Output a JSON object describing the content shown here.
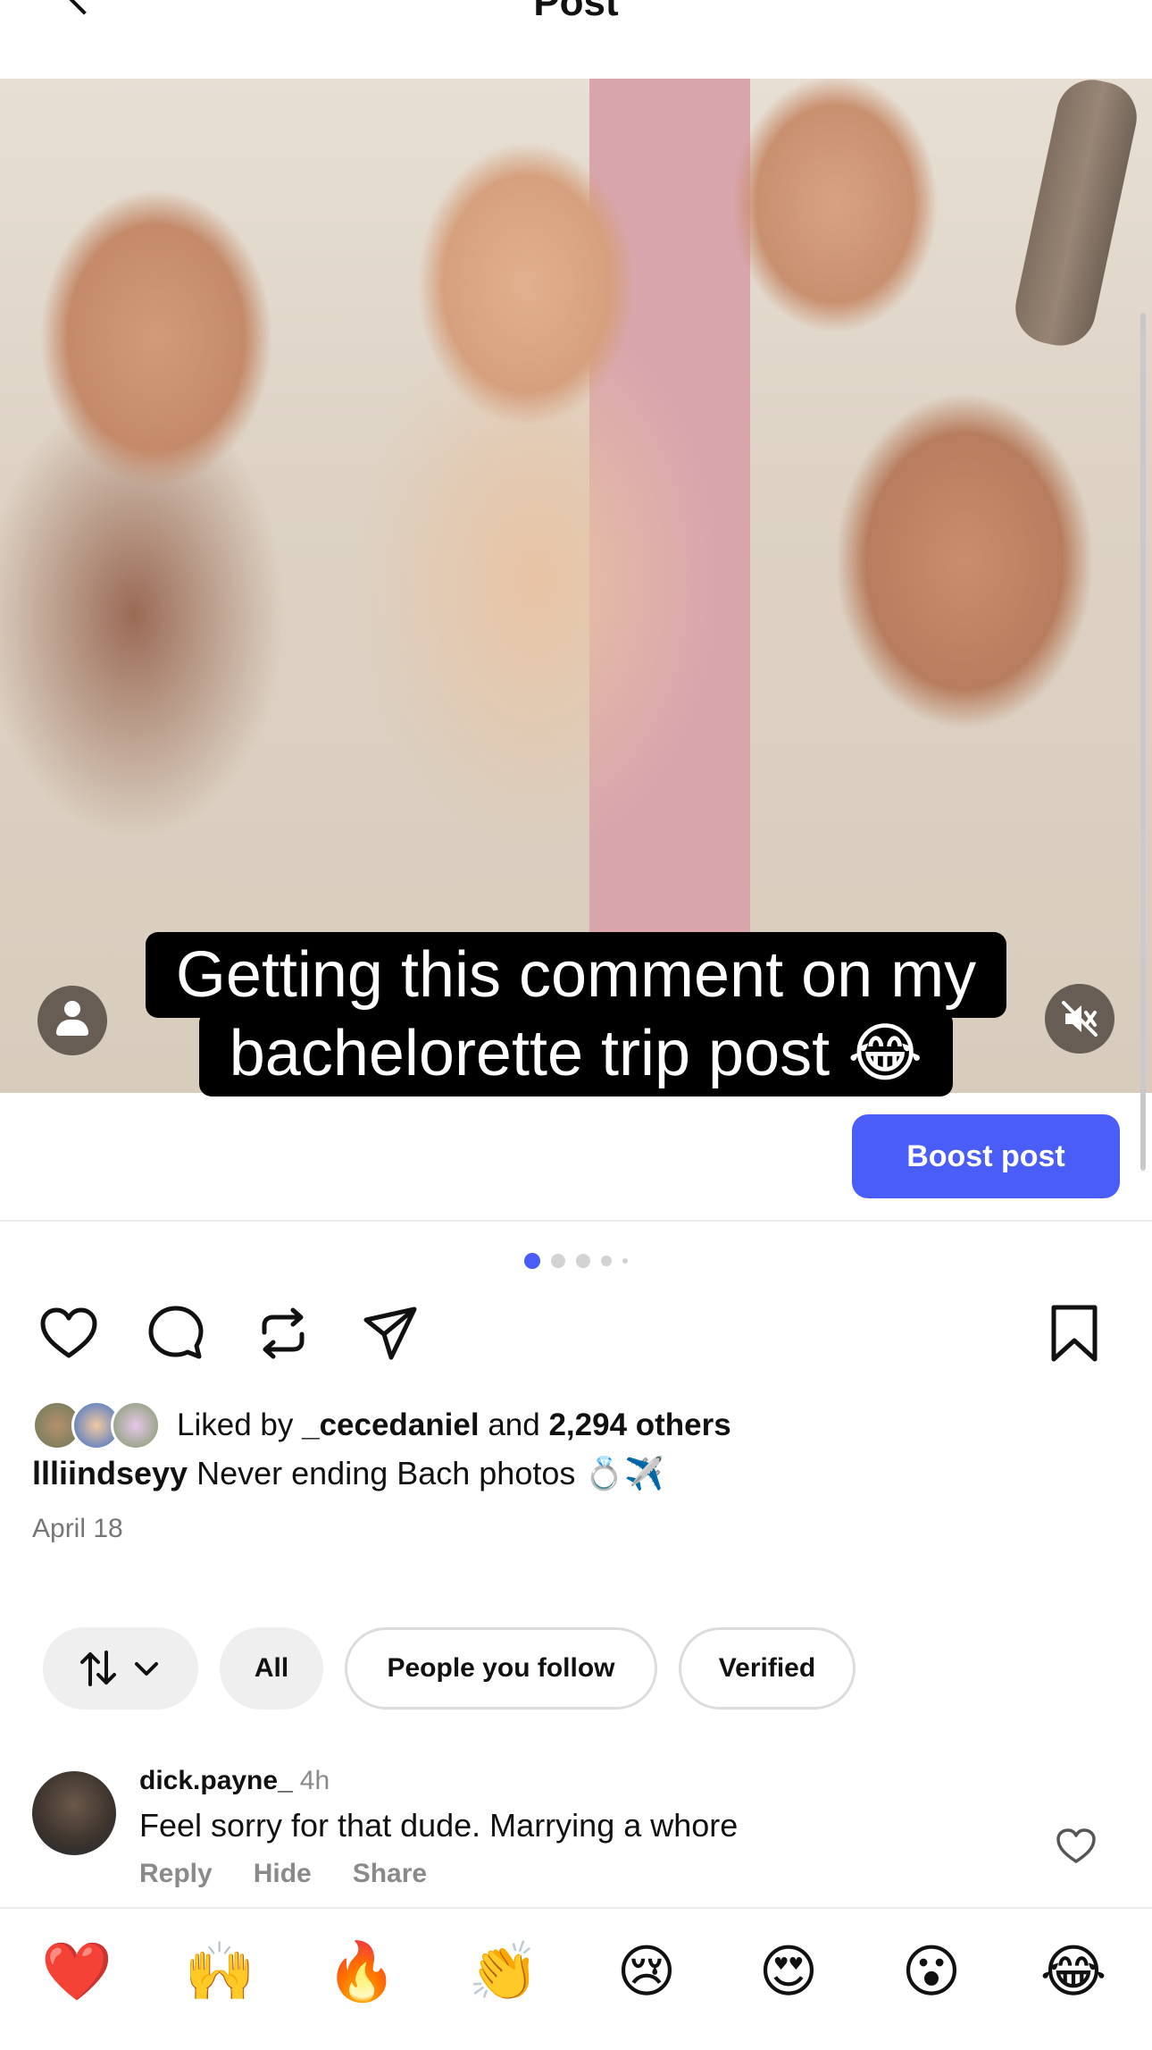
{
  "header": {
    "title": "Post"
  },
  "media": {
    "caption_line1": "Getting this comment on my",
    "caption_line2": "bachelorette trip post 😂"
  },
  "boost_label": "Boost post",
  "carousel": {
    "count": 5,
    "active_index": 0
  },
  "likes": {
    "prefix": "Liked by",
    "user": "_cecedaniel",
    "connector": "and",
    "others": "2,294 others"
  },
  "caption": {
    "username": "llliindseyy",
    "text": "Never ending Bach photos 💍✈️"
  },
  "date": "April 18",
  "filters": {
    "all": "All",
    "people_you_follow": "People you follow",
    "verified": "Verified"
  },
  "comment": {
    "username": "dick.payne_",
    "time": "4h",
    "text": "Feel sorry for that dude. Marrying a whore",
    "actions": {
      "reply": "Reply",
      "hide": "Hide",
      "share": "Share"
    }
  },
  "reactions": [
    {
      "name": "red-heart",
      "glyph": "❤️"
    },
    {
      "name": "raising-hands",
      "glyph": "🙌"
    },
    {
      "name": "fire",
      "glyph": "🔥"
    },
    {
      "name": "clapping-hands",
      "glyph": "👏"
    },
    {
      "name": "crying-face",
      "glyph": "😢"
    },
    {
      "name": "heart-eyes",
      "glyph": "😍"
    },
    {
      "name": "surprised-face",
      "glyph": "😮"
    },
    {
      "name": "tears-of-joy",
      "glyph": "😂"
    }
  ],
  "colors": {
    "accent": "#4a5df9",
    "muted_text": "#767676"
  }
}
